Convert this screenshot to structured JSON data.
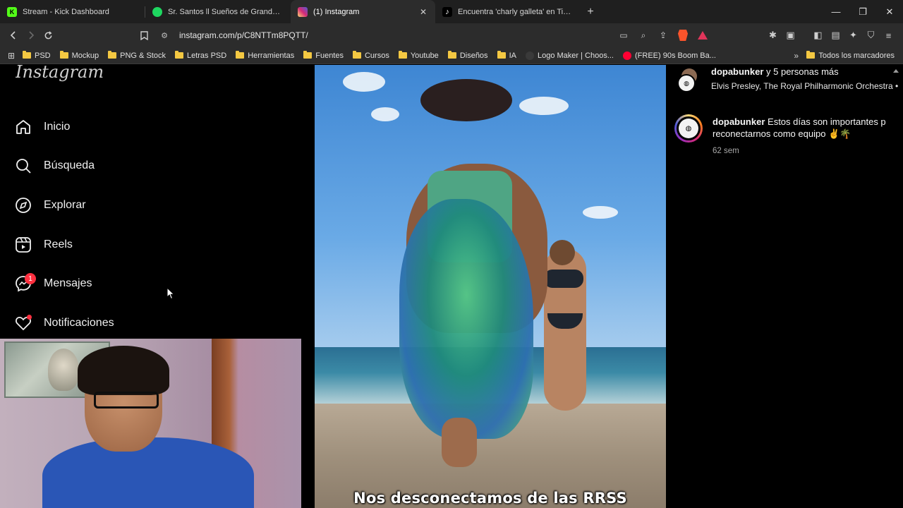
{
  "browser": {
    "tabs": [
      {
        "label": "Stream - Kick Dashboard",
        "favicon_letter": "K",
        "favicon_color": "#53fc18",
        "active": false
      },
      {
        "label": "Sr. Santos ll Sueños de Grandeza - A",
        "favicon_letter": "",
        "favicon_color": "#1ed760",
        "active": false
      },
      {
        "label": "(1) Instagram",
        "favicon_letter": "",
        "favicon_color": "#d62976",
        "active": true
      },
      {
        "label": "Encuentra 'charly galleta' en TikTok |",
        "favicon_letter": "♪",
        "favicon_color": "#ffffff",
        "active": false
      }
    ],
    "close_symbol": "✕",
    "newtab_symbol": "+",
    "url": "instagram.com/p/C8NTTm8PQTT/",
    "bookmarks": [
      {
        "label": "PSD",
        "type": "folder"
      },
      {
        "label": "Mockup",
        "type": "folder"
      },
      {
        "label": "PNG & Stock",
        "type": "folder"
      },
      {
        "label": "Letras PSD",
        "type": "folder"
      },
      {
        "label": "Herramientas",
        "type": "folder"
      },
      {
        "label": "Fuentes",
        "type": "folder"
      },
      {
        "label": "Cursos",
        "type": "folder"
      },
      {
        "label": "Youtube",
        "type": "folder"
      },
      {
        "label": "Diseños",
        "type": "folder"
      },
      {
        "label": "IA",
        "type": "folder"
      },
      {
        "label": "Logo Maker | Choos...",
        "type": "site",
        "color": "#333333"
      },
      {
        "label": "(FREE) 90s Boom Ba...",
        "type": "site",
        "color": "#ff0033"
      }
    ],
    "bookmarks_more": "»",
    "all_bookmarks": "Todos los marcadores"
  },
  "instagram": {
    "logo": "Instagram",
    "nav": [
      {
        "label": "Inicio",
        "icon": "home-icon"
      },
      {
        "label": "Búsqueda",
        "icon": "search-icon"
      },
      {
        "label": "Explorar",
        "icon": "compass-icon"
      },
      {
        "label": "Reels",
        "icon": "reels-icon"
      },
      {
        "label": "Mensajes",
        "icon": "messenger-icon",
        "badge": "1"
      },
      {
        "label": "Notificaciones",
        "icon": "heart-icon"
      }
    ],
    "video": {
      "subtitle": "Nos desconectamos de las RRSS"
    },
    "post": {
      "likes_user": "dopabunker",
      "likes_rest": " y 5 personas más",
      "audio": "Elvis Presley, The Royal Philharmonic Orchestra •",
      "caption_user": "dopabunker",
      "caption_line1": " Estos días son importantes p",
      "caption_line2": "reconectarnos como equipo ✌️🌴",
      "caption_time": "62 sem"
    }
  }
}
